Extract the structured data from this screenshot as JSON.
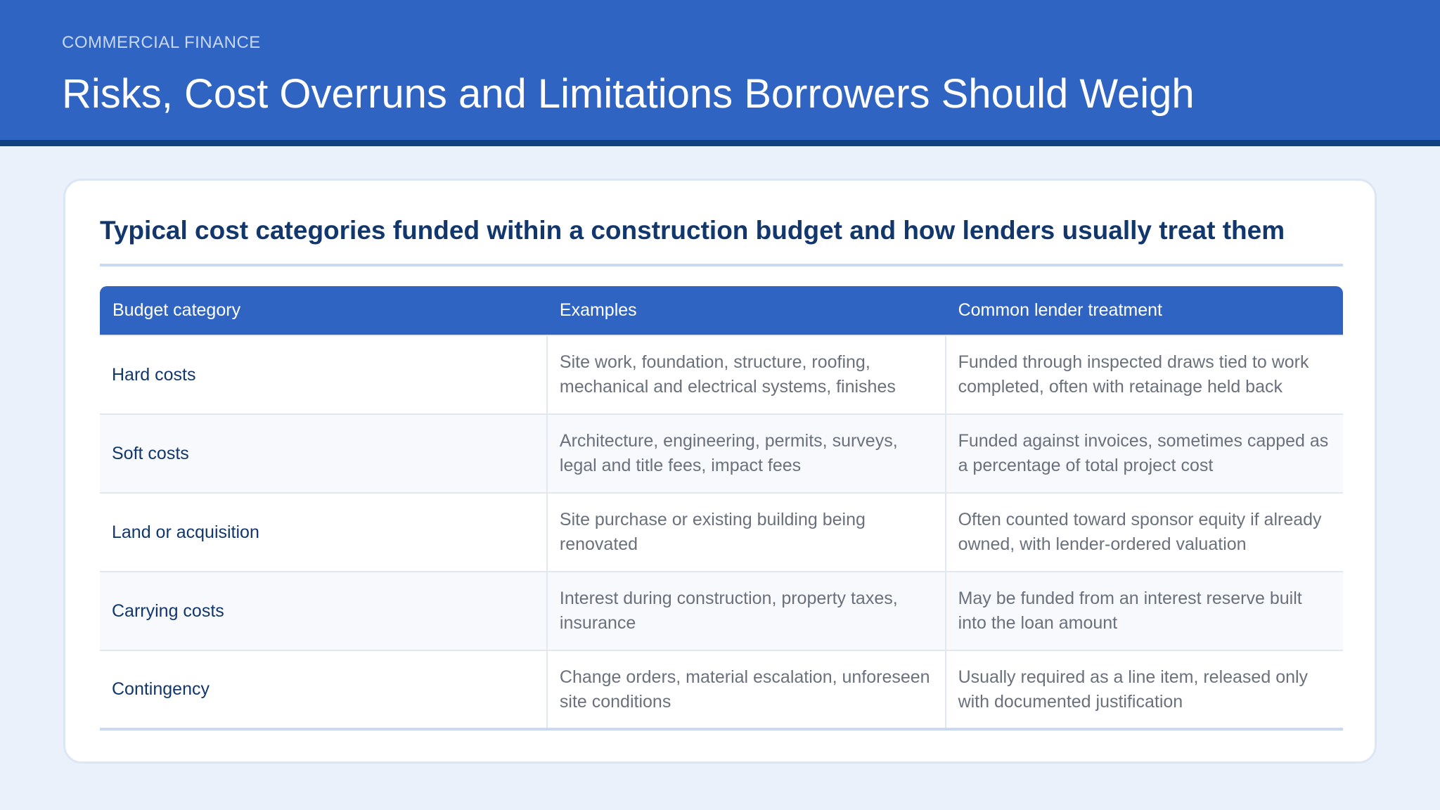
{
  "header": {
    "eyebrow": "COMMERCIAL FINANCE",
    "title": "Risks, Cost Overruns and Limitations Borrowers Should Weigh"
  },
  "card": {
    "title": "Typical cost categories funded within a construction budget and how lenders usually treat them"
  },
  "table": {
    "headers": [
      "Budget category",
      "Examples",
      "Common lender treatment"
    ],
    "rows": [
      {
        "category": "Hard costs",
        "examples": "Site work, foundation, structure, roofing, mechanical and electrical systems, finishes",
        "treatment": "Funded through inspected draws tied to work completed, often with retainage held back"
      },
      {
        "category": "Soft costs",
        "examples": "Architecture, engineering, permits, surveys, legal and title fees, impact fees",
        "treatment": "Funded against invoices, sometimes capped as a percentage of total project cost"
      },
      {
        "category": "Land or acquisition",
        "examples": "Site purchase or existing building being renovated",
        "treatment": "Often counted toward sponsor equity if already owned, with lender-ordered valuation"
      },
      {
        "category": "Carrying costs",
        "examples": "Interest during construction, property taxes, insurance",
        "treatment": "May be funded from an interest reserve built into the loan amount"
      },
      {
        "category": "Contingency",
        "examples": "Change orders, material escalation, unforeseen site conditions",
        "treatment": "Usually required as a line item, released only with documented justification"
      }
    ]
  }
}
